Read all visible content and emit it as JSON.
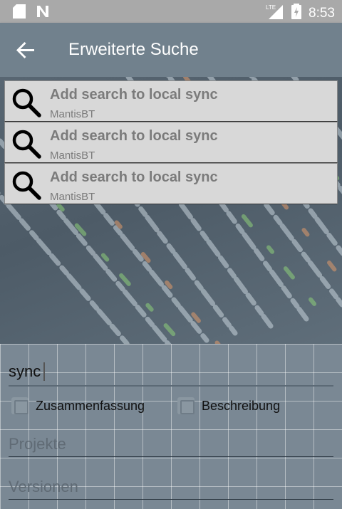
{
  "status_bar": {
    "left_icons": [
      "sd-card-icon",
      "n-notification-icon"
    ],
    "network": "LTE",
    "time": "8:53"
  },
  "app_bar": {
    "title": "Erweiterte Suche"
  },
  "suggestions": [
    {
      "title": "Add search to local sync",
      "subtitle": "MantisBT"
    },
    {
      "title": "Add search to local sync",
      "subtitle": "MantisBT"
    },
    {
      "title": "Add search to local sync",
      "subtitle": "MantisBT"
    }
  ],
  "form": {
    "search_value": "sync",
    "checkboxes": [
      {
        "label": "Zusammenfassung",
        "checked": false
      },
      {
        "label": "Beschreibung",
        "checked": false
      }
    ],
    "projects_placeholder": "Projekte",
    "versions_placeholder": "Versionen"
  },
  "colors": {
    "app_bar": "#71818d",
    "status_bar": "#a9a9a9",
    "suggestion_bg": "#d8d8d8"
  }
}
